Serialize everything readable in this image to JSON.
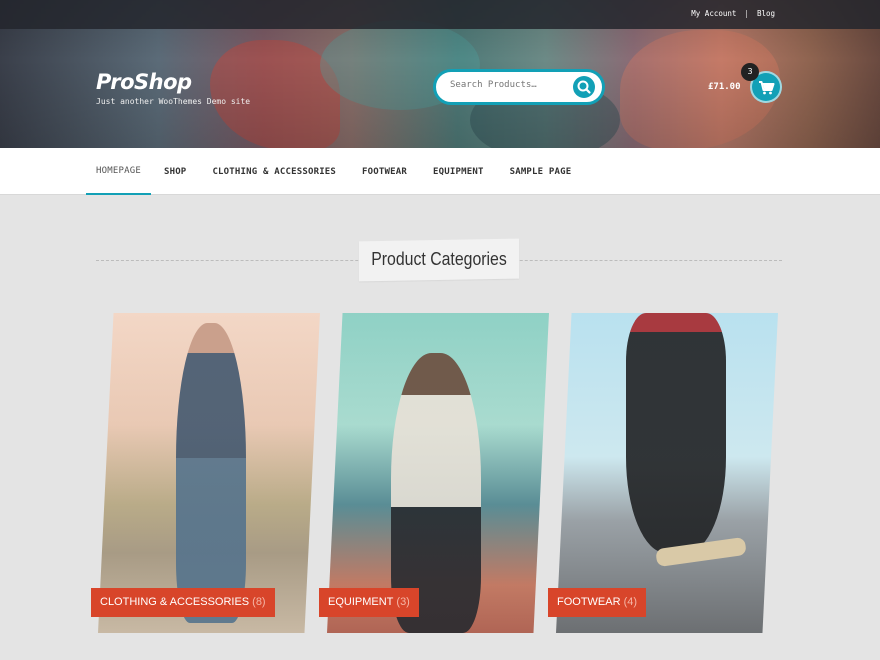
{
  "top_links": [
    "My Account",
    "Blog"
  ],
  "site": {
    "title": "ProShop",
    "tagline": "Just another WooThemes Demo site"
  },
  "search": {
    "placeholder": "Search Products…"
  },
  "cart": {
    "total": "£71.00",
    "count": "3"
  },
  "nav": [
    "HOMEPAGE",
    "SHOP",
    "CLOTHING & ACCESSORIES",
    "FOOTWEAR",
    "EQUIPMENT",
    "SAMPLE PAGE"
  ],
  "section_title": "Product Categories",
  "categories": [
    {
      "name": "CLOTHING & ACCESSORIES",
      "count": "(8)"
    },
    {
      "name": "EQUIPMENT",
      "count": "(3)"
    },
    {
      "name": "FOOTWEAR",
      "count": "(4)"
    }
  ],
  "colors": {
    "accent": "#12a0b6",
    "badge": "#d8452a"
  }
}
